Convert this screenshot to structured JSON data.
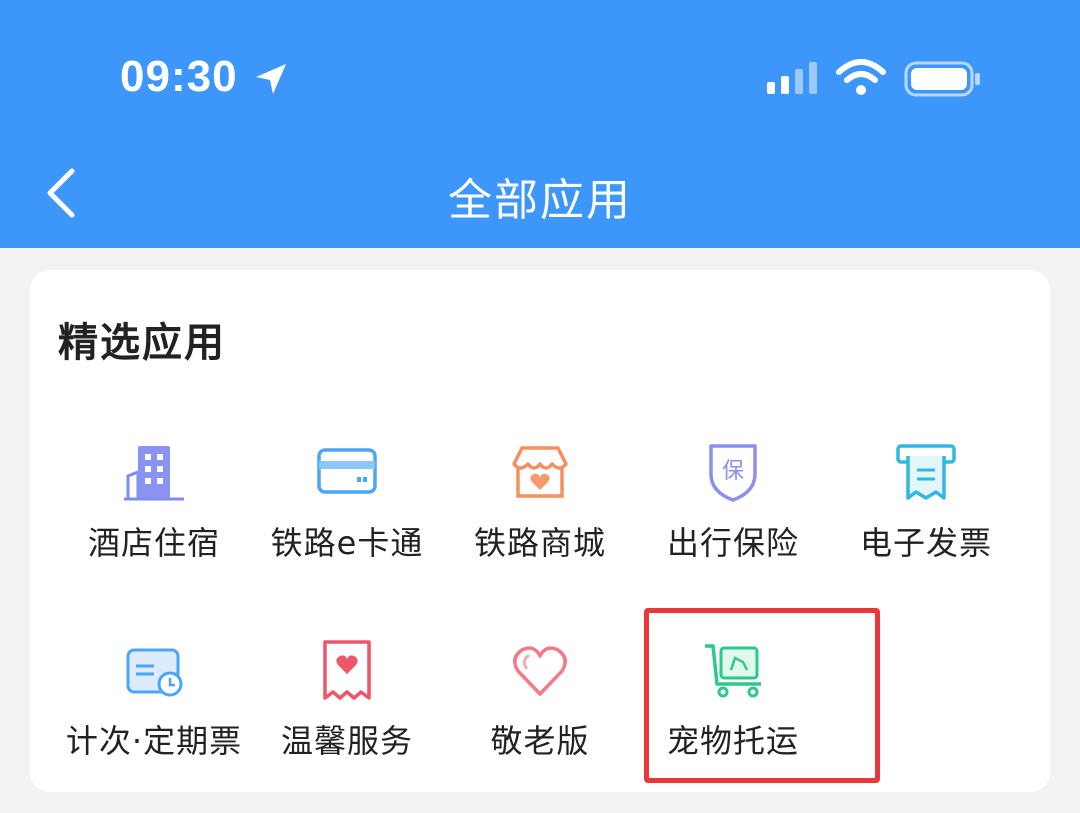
{
  "status_bar": {
    "time": "09:30"
  },
  "nav": {
    "title": "全部应用"
  },
  "section": {
    "title": "精选应用"
  },
  "apps": [
    {
      "label": "酒店住宿",
      "icon": "hotel-building-icon"
    },
    {
      "label": "铁路e卡通",
      "icon": "rail-card-icon"
    },
    {
      "label": "铁路商城",
      "icon": "mall-shop-icon"
    },
    {
      "label": "出行保险",
      "icon": "insurance-shield-icon"
    },
    {
      "label": "电子发票",
      "icon": "invoice-receipt-icon"
    },
    {
      "label": "计次·定期票",
      "icon": "period-ticket-clock-icon"
    },
    {
      "label": "温馨服务",
      "icon": "care-service-heart-icon"
    },
    {
      "label": "敬老版",
      "icon": "elderly-heart-icon"
    },
    {
      "label": "宠物托运",
      "icon": "pet-cart-icon"
    }
  ],
  "colors": {
    "header": "#3d96fa",
    "highlight": "#e8383b",
    "background": "#f2f3f5"
  }
}
